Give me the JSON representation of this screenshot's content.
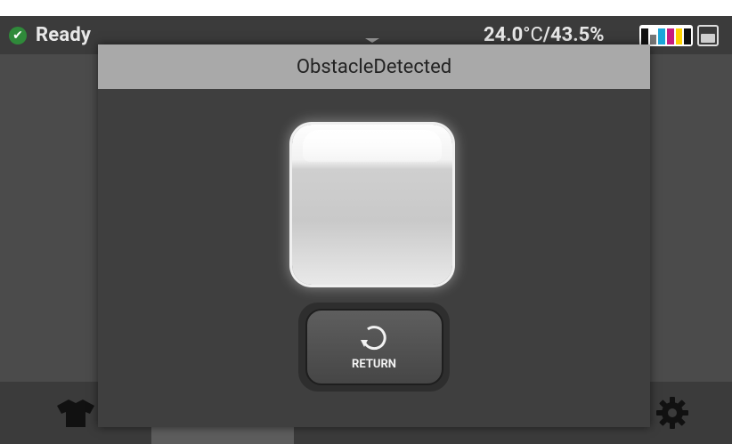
{
  "status": {
    "state_label": "Ready",
    "temperature": "24.0",
    "temp_unit": "°C",
    "humidity": "43.5%",
    "separator": " / "
  },
  "ink_levels": [
    {
      "name": "black",
      "level": 0.9,
      "color": "#111111"
    },
    {
      "name": "white",
      "level": 0.55,
      "color": "#777777"
    },
    {
      "name": "cyan",
      "level": 0.9,
      "color": "#1aa6d9"
    },
    {
      "name": "magenta",
      "level": 0.9,
      "color": "#c71b7f"
    },
    {
      "name": "yellow",
      "level": 0.9,
      "color": "#ffd200"
    },
    {
      "name": "black-2",
      "level": 0.9,
      "color": "#111111"
    }
  ],
  "maintenance_box_level": 0.6,
  "dialog": {
    "title": "ObstacleDetected",
    "return_label": "RETURN"
  },
  "bottom_nav": {
    "items": [
      {
        "name": "print-item",
        "icon": "tshirt-icon"
      },
      {
        "name": "platen-item",
        "icon": "platen-icon",
        "active": true
      },
      {
        "name": "adjust-item",
        "icon": "align-center-icon"
      },
      {
        "name": "transfer-item",
        "icon": "transfer-icon"
      },
      {
        "name": "settings-item",
        "icon": "gear-icon"
      }
    ]
  }
}
